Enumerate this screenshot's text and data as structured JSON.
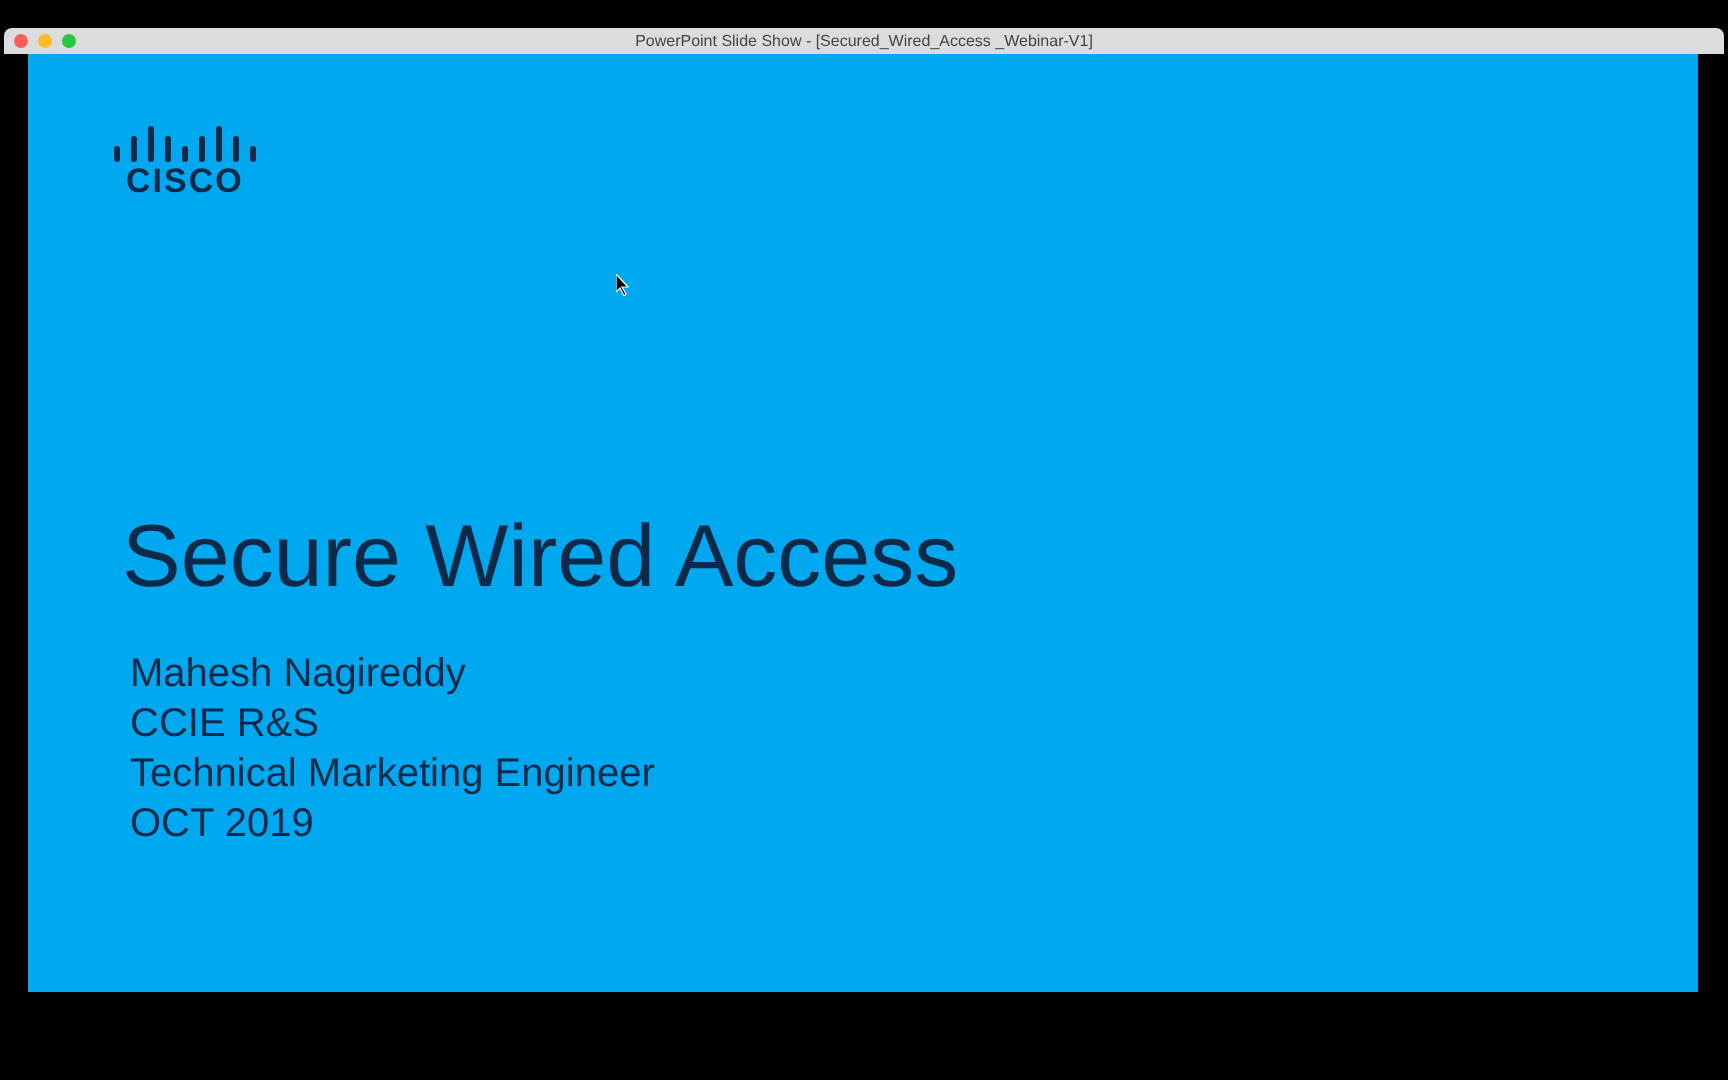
{
  "window": {
    "title": "PowerPoint Slide Show - [Secured_Wired_Access _Webinar-V1]"
  },
  "slide": {
    "logo_text": "CISCO",
    "title": "Secure Wired Access",
    "lines": [
      "Mahesh Nagireddy",
      "CCIE R&S",
      "Technical Marketing Engineer",
      "OCT 2019"
    ]
  }
}
